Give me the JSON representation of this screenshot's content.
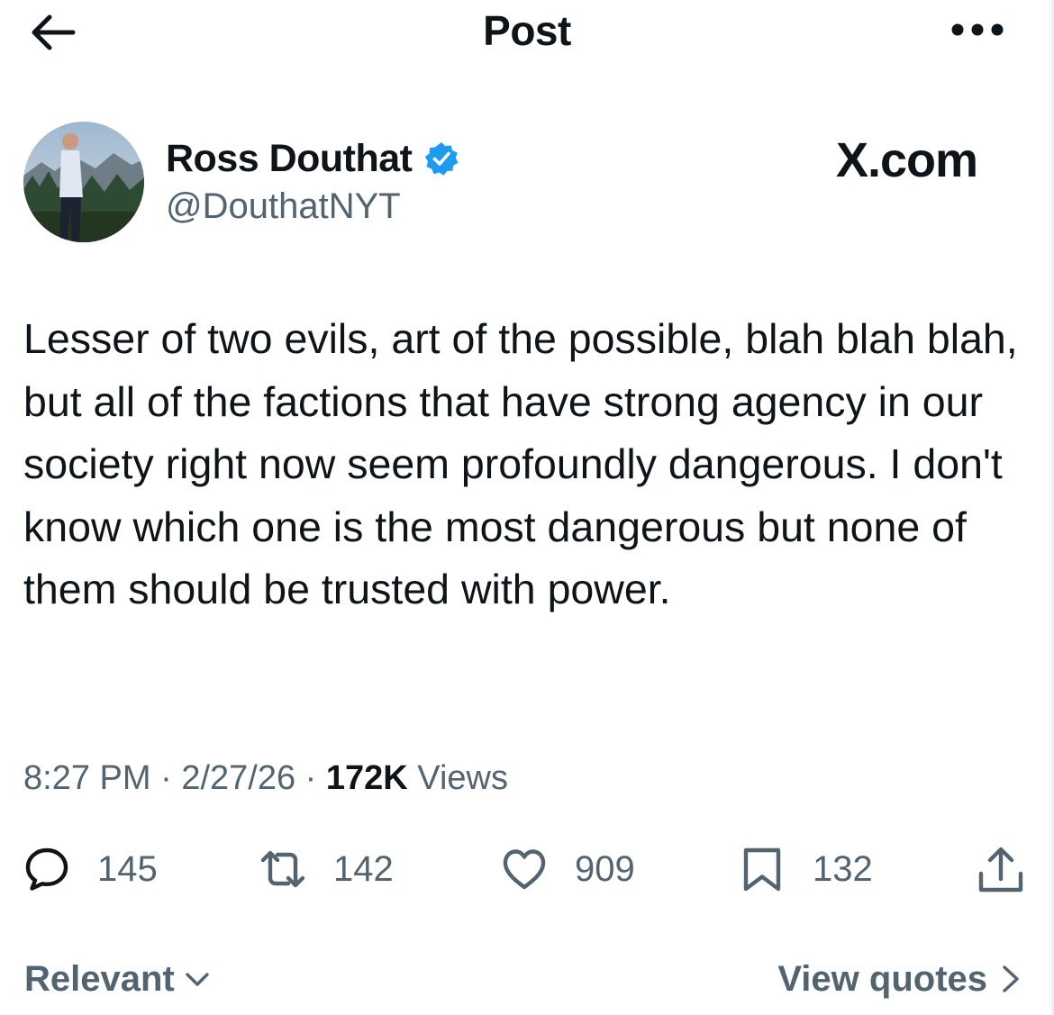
{
  "header": {
    "title": "Post",
    "back_icon": "arrow-left-icon",
    "more_icon": "more-horizontal-icon"
  },
  "author": {
    "name": "Ross Douthat",
    "handle": "@DouthatNYT",
    "verified": true,
    "verified_color": "#1d9bf0"
  },
  "source_mark": "X.com",
  "tweet": {
    "text": "Lesser of two evils, art of the possible, blah blah blah, but all of the factions that have strong agency in our society right now seem profoundly dangerous. I don't know which one is the most dangerous but none of them should be trusted with power."
  },
  "meta": {
    "time": "8:27 PM",
    "date": "2/27/26",
    "views_count": "172K",
    "views_label": "Views"
  },
  "actions": {
    "replies": "145",
    "reposts": "142",
    "likes": "909",
    "bookmarks": "132"
  },
  "footer": {
    "sort_label": "Relevant",
    "view_quotes_label": "View quotes"
  },
  "colors": {
    "text_primary": "#0f1419",
    "text_secondary": "#536471",
    "accent": "#1d9bf0"
  }
}
